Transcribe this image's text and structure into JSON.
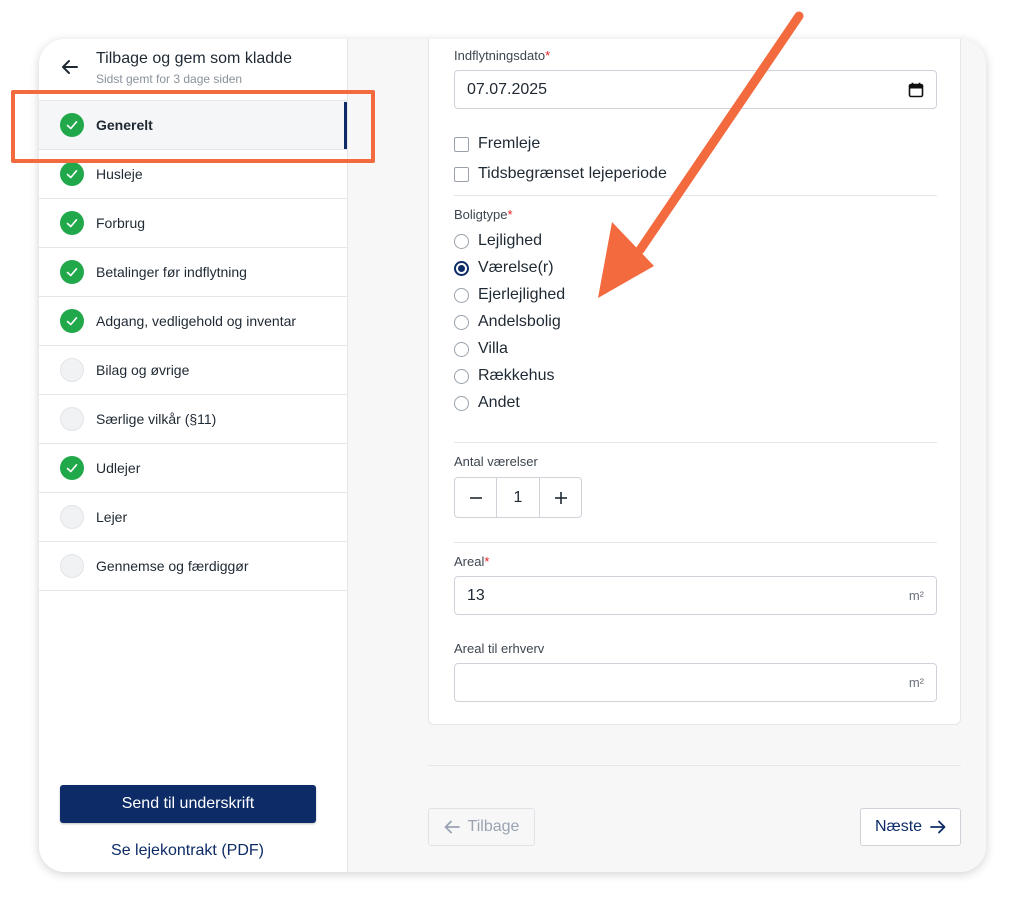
{
  "sidebar": {
    "title": "Tilbage og gem som kladde",
    "subtitle": "Sidst gemt for 3 dage siden",
    "steps": [
      {
        "label": "Generelt",
        "done": true,
        "active": true
      },
      {
        "label": "Husleje",
        "done": true
      },
      {
        "label": "Forbrug",
        "done": true
      },
      {
        "label": "Betalinger før indflytning",
        "done": true
      },
      {
        "label": "Adgang, vedligehold og inventar",
        "done": true
      },
      {
        "label": "Bilag og øvrige",
        "done": false
      },
      {
        "label": "Særlige vilkår (§11)",
        "done": false
      },
      {
        "label": "Udlejer",
        "done": true
      },
      {
        "label": "Lejer",
        "done": false
      },
      {
        "label": "Gennemse og færdiggør",
        "done": false
      }
    ],
    "send_label": "Send til underskrift",
    "pdf_label": "Se lejekontrakt (PDF)"
  },
  "form": {
    "move_in_label": "Indflytningsdato",
    "move_in_value": "07.07.2025",
    "required_mark": "*",
    "sublet_label": "Fremleje",
    "limited_label": "Tidsbegrænset lejeperiode",
    "housing_type_label": "Boligtype",
    "housing_types": [
      "Lejlighed",
      "Værelse(r)",
      "Ejerlejlighed",
      "Andelsbolig",
      "Villa",
      "Rækkehus",
      "Andet"
    ],
    "housing_selected": "Værelse(r)",
    "rooms_label": "Antal værelser",
    "rooms_value": "1",
    "area_label": "Areal",
    "area_value": "13",
    "area_unit": "m²",
    "business_area_label": "Areal til erhverv",
    "business_area_value": "",
    "business_area_unit": "m²"
  },
  "footer": {
    "back_label": "Tilbage",
    "next_label": "Næste"
  },
  "colors": {
    "primary": "#0d2b67",
    "success": "#20a84b",
    "annotation": "#f26a3d",
    "required": "#e02424"
  }
}
